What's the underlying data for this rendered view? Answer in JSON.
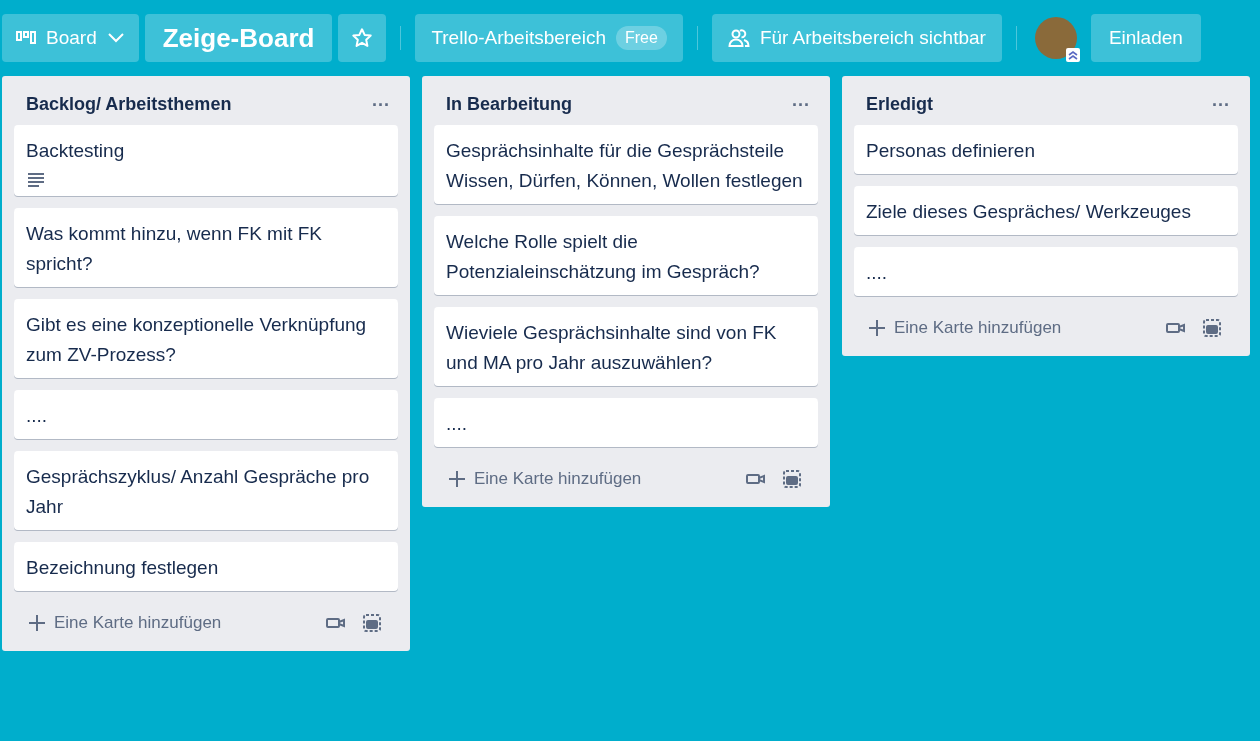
{
  "header": {
    "view_switcher": "Board",
    "board_title": "Zeige-Board",
    "starred": false,
    "workspace": {
      "name": "Trello-Arbeitsbereich",
      "plan": "Free"
    },
    "visibility": "Für Arbeitsbereich sichtbar",
    "invite": "Einladen"
  },
  "lists": [
    {
      "title": "Backlog/ Arbeitsthemen",
      "menu": "...",
      "add_card": "Eine Karte hinzufügen",
      "cards": [
        {
          "title": "Backtesting",
          "has_description": true
        },
        {
          "title": "Was kommt hinzu, wenn FK mit FK spricht?",
          "has_description": false
        },
        {
          "title": "Gibt es eine konzeptionelle Verknüpfung zum ZV-Prozess?",
          "has_description": false
        },
        {
          "title": "....",
          "has_description": false
        },
        {
          "title": "Gesprächszyklus/ Anzahl Gespräche pro Jahr",
          "has_description": false
        },
        {
          "title": "Bezeichnung festlegen",
          "has_description": false
        }
      ]
    },
    {
      "title": "In Bearbeitung",
      "menu": "...",
      "add_card": "Eine Karte hinzufügen",
      "cards": [
        {
          "title": "Gesprächsinhalte für die Gesprächsteile Wissen, Dürfen, Können, Wollen festlegen",
          "has_description": false
        },
        {
          "title": "Welche Rolle spielt die Potenzialeinschätzung im Gespräch?",
          "has_description": false
        },
        {
          "title": "Wieviele Gesprächsinhalte sind von FK und MA pro Jahr auszuwählen?",
          "has_description": false
        },
        {
          "title": "....",
          "has_description": false
        }
      ]
    },
    {
      "title": "Erledigt",
      "menu": "...",
      "add_card": "Eine Karte hinzufügen",
      "cards": [
        {
          "title": "Personas definieren",
          "has_description": false
        },
        {
          "title": "Ziele dieses Gespräches/ Werkzeuges",
          "has_description": false
        },
        {
          "title": "....",
          "has_description": false
        }
      ]
    }
  ]
}
